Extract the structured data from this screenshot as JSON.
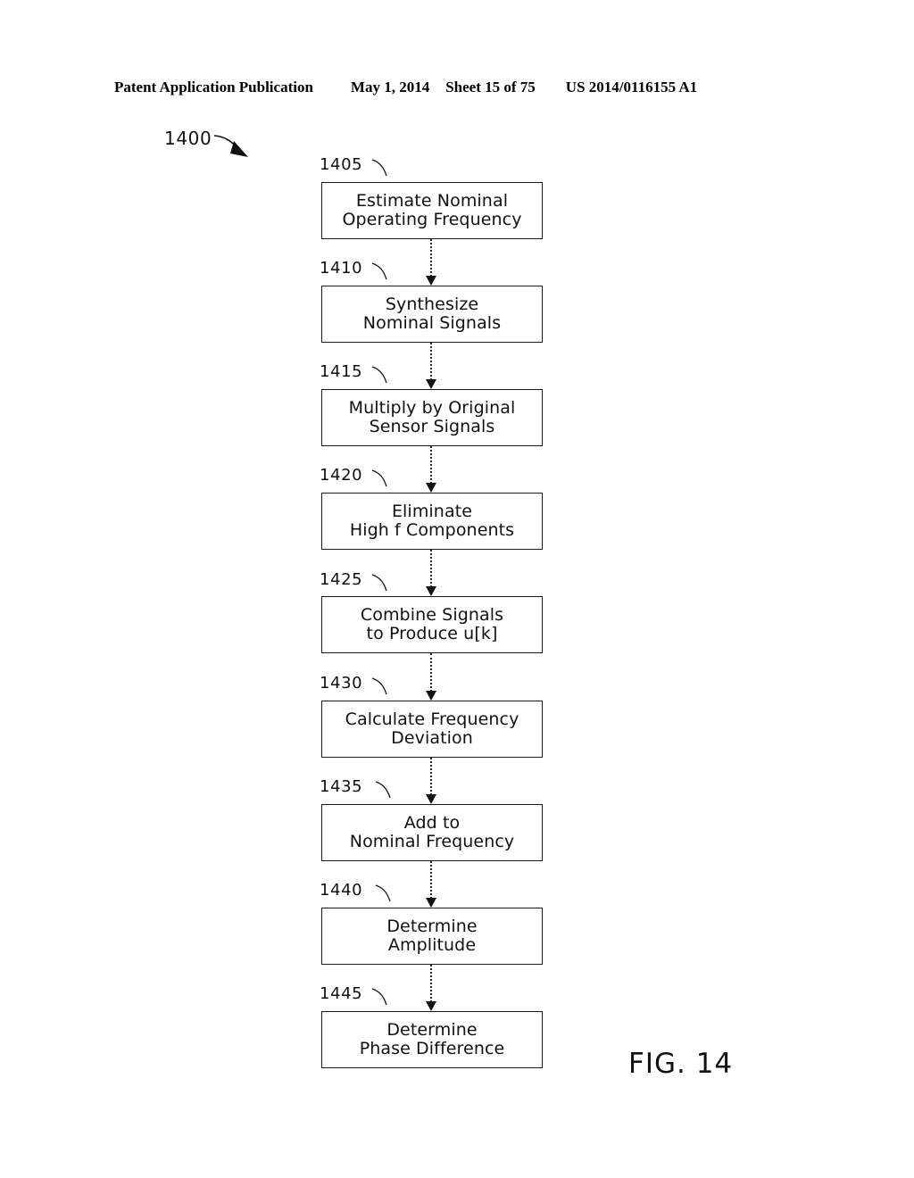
{
  "header": {
    "publication": "Patent Application Publication",
    "date": "May 1, 2014",
    "sheet": "Sheet 15 of 75",
    "patent_number": "US 2014/0116155 A1"
  },
  "figure": {
    "id_label": "1400",
    "caption": "FIG. 14",
    "ink_color": "#111111",
    "background": "#ffffff"
  },
  "flowchart": {
    "steps": [
      {
        "ref": "1405",
        "line1": "Estimate Nominal",
        "line2": "Operating Frequency"
      },
      {
        "ref": "1410",
        "line1": "Synthesize",
        "line2": "Nominal Signals"
      },
      {
        "ref": "1415",
        "line1": "Multiply by Original",
        "line2": "Sensor Signals"
      },
      {
        "ref": "1420",
        "line1": "Eliminate",
        "line2": "High f Components"
      },
      {
        "ref": "1425",
        "line1": "Combine Signals",
        "line2": "to Produce u[k]"
      },
      {
        "ref": "1430",
        "line1": "Calculate Frequency",
        "line2": "Deviation"
      },
      {
        "ref": "1435",
        "line1": "Add to",
        "line2": "Nominal Frequency"
      },
      {
        "ref": "1440",
        "line1": "Determine",
        "line2": "Amplitude"
      },
      {
        "ref": "1445",
        "line1": "Determine",
        "line2": "Phase Difference"
      }
    ]
  }
}
